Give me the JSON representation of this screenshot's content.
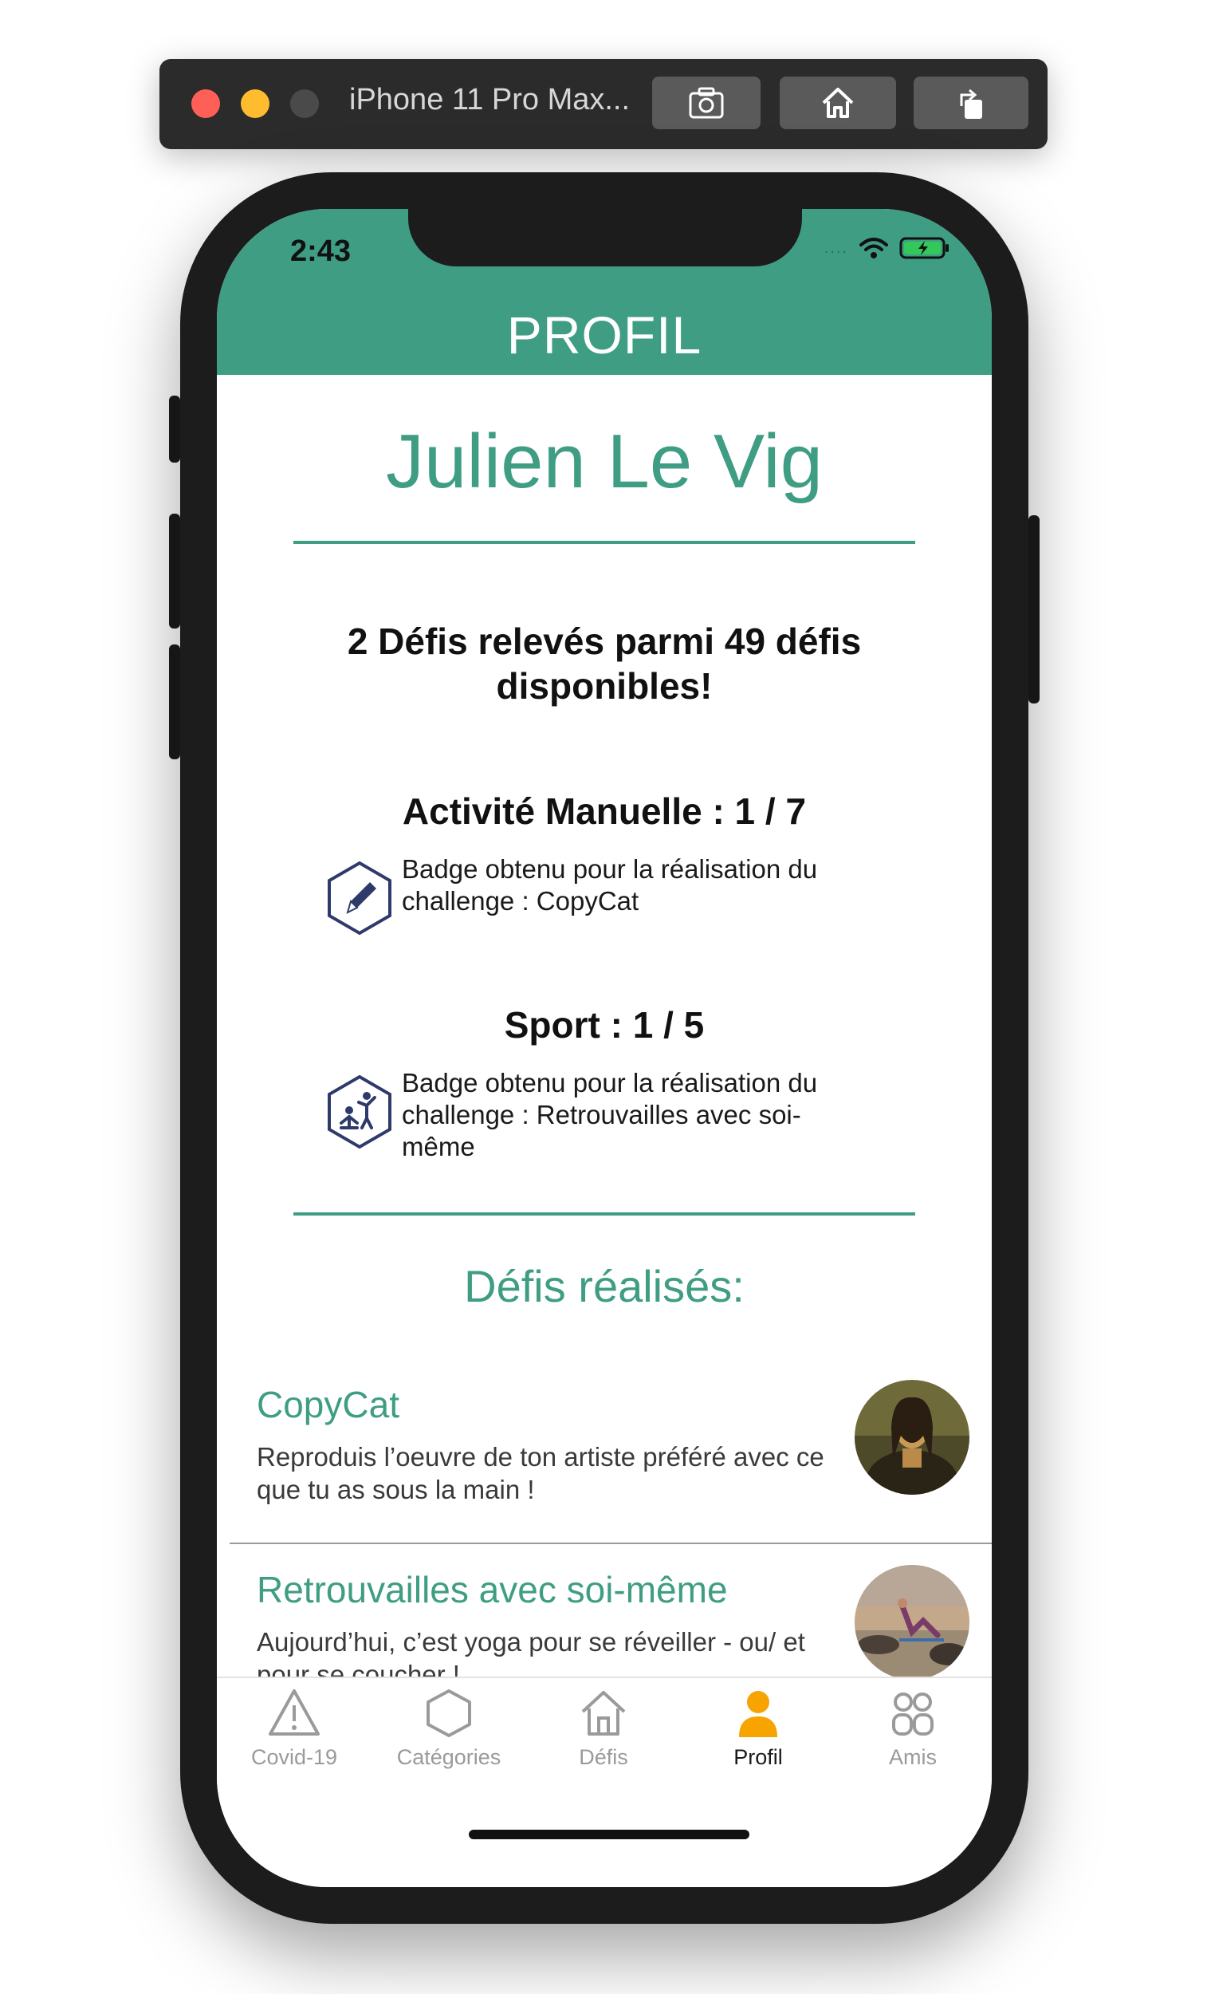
{
  "simulator": {
    "title": "iPhone 11 Pro Max...",
    "buttons": [
      "screenshot-icon",
      "home-icon",
      "rotate-icon"
    ]
  },
  "status_bar": {
    "time": "2:43",
    "signal_dots": "....",
    "icons": [
      "wifi-icon",
      "battery-charging-icon"
    ]
  },
  "header": {
    "title": "PROFIL"
  },
  "profile": {
    "name": "Julien Le Vig",
    "summary": "2 Défis relevés parmi 49 défis disponibles!"
  },
  "categories": [
    {
      "title": "Activité Manuelle : 1 / 7",
      "badge_icon": "pencil-badge-icon",
      "badge_text": "Badge obtenu pour la réalisation du challenge : CopyCat"
    },
    {
      "title": "Sport : 1 / 5",
      "badge_icon": "sport-badge-icon",
      "badge_text": "Badge obtenu pour la réalisation du challenge : Retrouvailles avec soi-même"
    }
  ],
  "completed": {
    "title": "Défis réalisés:",
    "items": [
      {
        "title": "CopyCat",
        "description": "Reproduis l’oeuvre de ton artiste préféré avec ce que tu as sous la main !",
        "thumbnail": "mona-lisa-thumbnail"
      },
      {
        "title": "Retrouvailles avec soi-même",
        "description": "Aujourd’hui, c’est yoga pour se réveiller - ou/ et pour se coucher !",
        "thumbnail": "yoga-beach-thumbnail"
      }
    ]
  },
  "tabbar": {
    "tabs": [
      {
        "label": "Covid-19",
        "icon": "warning-icon",
        "active": false
      },
      {
        "label": "Catégories",
        "icon": "hexagon-icon",
        "active": false
      },
      {
        "label": "Défis",
        "icon": "house-icon",
        "active": false
      },
      {
        "label": "Profil",
        "icon": "person-icon",
        "active": true
      },
      {
        "label": "Amis",
        "icon": "friends-icon",
        "active": false
      }
    ]
  },
  "colors": {
    "accent": "#3f9d84",
    "active_tab": "#f7a400",
    "inactive_tab": "#9a9a9a"
  }
}
